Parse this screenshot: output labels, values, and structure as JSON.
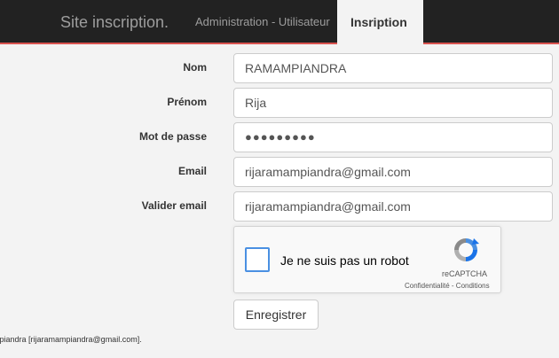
{
  "navbar": {
    "brand": "Site inscription.",
    "links": [
      "Administration - Utilisateur"
    ],
    "active_tab": "Insription"
  },
  "form": {
    "nom": {
      "label": "Nom",
      "value": "RAMAMPIANDRA"
    },
    "prenom": {
      "label": "Prénom",
      "value": "Rija"
    },
    "password": {
      "label": "Mot de passe",
      "value": "●●●●●●●●●"
    },
    "email": {
      "label": "Email",
      "value": "rijaramampiandra@gmail.com"
    },
    "email_confirm": {
      "label": "Valider email",
      "value": "rijaramampiandra@gmail.com"
    },
    "submit_label": "Enregistrer"
  },
  "captcha": {
    "label": "Je ne suis pas un robot",
    "brand": "reCAPTCHA",
    "links": "Confidentialité - Conditions"
  },
  "footer": {
    "text": "mpiandra [rijaramampiandra@gmail.com]."
  },
  "colors": {
    "navbar_bg": "#222222",
    "navbar_border": "#d9534f",
    "page_bg": "#f3f3f3",
    "captcha_accent": "#4a90e2"
  }
}
